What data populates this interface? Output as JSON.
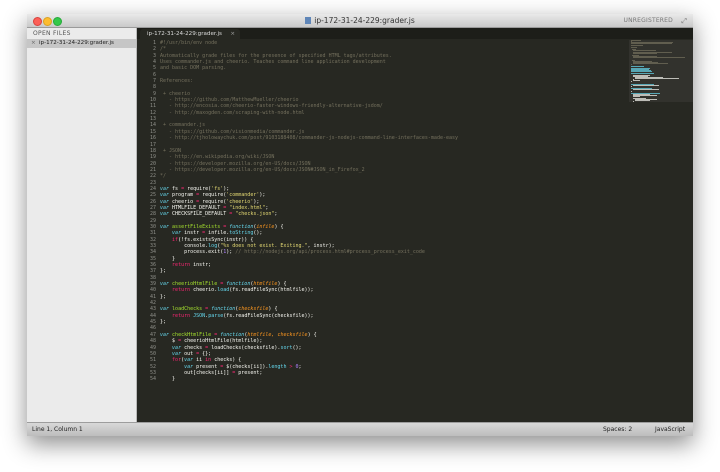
{
  "window": {
    "title": "ip-172-31-24-229:grader.js",
    "license": "UNREGISTERED"
  },
  "sidebar": {
    "header": "OPEN FILES",
    "files": [
      {
        "close": "×",
        "name": "ip-172-31-24-229:grader.js"
      }
    ]
  },
  "tabs": [
    {
      "label": "ip-172-31-24-229:grader.js",
      "close": "×"
    }
  ],
  "status": {
    "position": "Line 1, Column 1",
    "indent": "Spaces: 2",
    "syntax": "JavaScript"
  },
  "editor": {
    "lines": [
      [
        [
          "c",
          "#!/usr/bin/env node"
        ]
      ],
      [
        [
          "c",
          "/*"
        ]
      ],
      [
        [
          "c",
          "Automatically grade files for the presence of specified HTML tags/attributes."
        ]
      ],
      [
        [
          "c",
          "Uses commander.js and cheerio. Teaches command line application development"
        ]
      ],
      [
        [
          "c",
          "and basic DOM parsing."
        ]
      ],
      [],
      [
        [
          "c",
          "References:"
        ]
      ],
      [],
      [
        [
          "c",
          " + cheerio"
        ]
      ],
      [
        [
          "c",
          "   - https://github.com/MatthewMueller/cheerio"
        ]
      ],
      [
        [
          "c",
          "   - http://encosia.com/cheerio-faster-windows-friendly-alternative-jsdom/"
        ]
      ],
      [
        [
          "c",
          "   - http://maxogden.com/scraping-with-node.html"
        ]
      ],
      [],
      [
        [
          "c",
          " + commander.js"
        ]
      ],
      [
        [
          "c",
          "   - https://github.com/visionmedia/commander.js"
        ]
      ],
      [
        [
          "c",
          "   - http://tjholowaychuk.com/post/9103188408/commander-js-nodejs-command-line-interfaces-made-easy"
        ]
      ],
      [],
      [
        [
          "c",
          " + JSON"
        ]
      ],
      [
        [
          "c",
          "   - http://en.wikipedia.org/wiki/JSON"
        ]
      ],
      [
        [
          "c",
          "   - https://developer.mozilla.org/en-US/docs/JSON"
        ]
      ],
      [
        [
          "c",
          "   - https://developer.mozilla.org/en-US/docs/JSON#JSON_in_Firefox_2"
        ]
      ],
      [
        [
          "c",
          "*/"
        ]
      ],
      [],
      [
        [
          "kt",
          "var"
        ],
        [
          "t",
          " fs "
        ],
        [
          "k",
          "="
        ],
        [
          "t",
          " require("
        ],
        [
          "s",
          "'fs'"
        ],
        [
          "t",
          ");"
        ]
      ],
      [
        [
          "kt",
          "var"
        ],
        [
          "t",
          " program "
        ],
        [
          "k",
          "="
        ],
        [
          "t",
          " require("
        ],
        [
          "s",
          "'commander'"
        ],
        [
          "t",
          ");"
        ]
      ],
      [
        [
          "kt",
          "var"
        ],
        [
          "t",
          " cheerio "
        ],
        [
          "k",
          "="
        ],
        [
          "t",
          " require("
        ],
        [
          "s",
          "'cheerio'"
        ],
        [
          "t",
          ");"
        ]
      ],
      [
        [
          "kt",
          "var"
        ],
        [
          "t",
          " HTMLFILE_DEFAULT "
        ],
        [
          "k",
          "="
        ],
        [
          "t",
          " "
        ],
        [
          "s",
          "\"index.html\""
        ],
        [
          "t",
          ";"
        ]
      ],
      [
        [
          "kt",
          "var"
        ],
        [
          "t",
          " CHECKSFILE_DEFAULT "
        ],
        [
          "k",
          "="
        ],
        [
          "t",
          " "
        ],
        [
          "s",
          "\"checks.json\""
        ],
        [
          "t",
          ";"
        ]
      ],
      [],
      [
        [
          "kt",
          "var"
        ],
        [
          "t",
          " "
        ],
        [
          "f",
          "assertFileExists"
        ],
        [
          "t",
          " "
        ],
        [
          "k",
          "="
        ],
        [
          "t",
          " "
        ],
        [
          "kt",
          "function"
        ],
        [
          "t",
          "("
        ],
        [
          "p",
          "infile"
        ],
        [
          "t",
          ") {"
        ]
      ],
      [
        [
          "t",
          "    "
        ],
        [
          "kt",
          "var"
        ],
        [
          "t",
          " instr "
        ],
        [
          "k",
          "="
        ],
        [
          "t",
          " infile."
        ],
        [
          "b",
          "toString"
        ],
        [
          "t",
          "();"
        ]
      ],
      [
        [
          "t",
          "    "
        ],
        [
          "k",
          "if"
        ],
        [
          "t",
          "(!fs.existsSync(instr)) {"
        ]
      ],
      [
        [
          "t",
          "        console."
        ],
        [
          "b",
          "log"
        ],
        [
          "t",
          "("
        ],
        [
          "s",
          "\"%s does not exist. Exiting.\""
        ],
        [
          "t",
          ", instr);"
        ]
      ],
      [
        [
          "t",
          "        process.exit("
        ],
        [
          "n",
          "1"
        ],
        [
          "t",
          "); "
        ],
        [
          "c",
          "// http://nodejs.org/api/process.html#process_process_exit_code"
        ]
      ],
      [
        [
          "t",
          "    }"
        ]
      ],
      [
        [
          "t",
          "    "
        ],
        [
          "k",
          "return"
        ],
        [
          "t",
          " instr;"
        ]
      ],
      [
        [
          "t",
          "};"
        ]
      ],
      [],
      [
        [
          "kt",
          "var"
        ],
        [
          "t",
          " "
        ],
        [
          "f",
          "cheerioHtmlFile"
        ],
        [
          "t",
          " "
        ],
        [
          "k",
          "="
        ],
        [
          "t",
          " "
        ],
        [
          "kt",
          "function"
        ],
        [
          "t",
          "("
        ],
        [
          "p",
          "htmlfile"
        ],
        [
          "t",
          ") {"
        ]
      ],
      [
        [
          "t",
          "    "
        ],
        [
          "k",
          "return"
        ],
        [
          "t",
          " cheerio."
        ],
        [
          "b",
          "load"
        ],
        [
          "t",
          "(fs.readFileSync(htmlfile));"
        ]
      ],
      [
        [
          "t",
          "};"
        ]
      ],
      [],
      [
        [
          "kt",
          "var"
        ],
        [
          "t",
          " "
        ],
        [
          "f",
          "loadChecks"
        ],
        [
          "t",
          " "
        ],
        [
          "k",
          "="
        ],
        [
          "t",
          " "
        ],
        [
          "kt",
          "function"
        ],
        [
          "t",
          "("
        ],
        [
          "p",
          "checksfile"
        ],
        [
          "t",
          ") {"
        ]
      ],
      [
        [
          "t",
          "    "
        ],
        [
          "k",
          "return"
        ],
        [
          "t",
          " "
        ],
        [
          "b",
          "JSON"
        ],
        [
          "t",
          "."
        ],
        [
          "b",
          "parse"
        ],
        [
          "t",
          "(fs.readFileSync(checksfile));"
        ]
      ],
      [
        [
          "t",
          "};"
        ]
      ],
      [],
      [
        [
          "kt",
          "var"
        ],
        [
          "t",
          " "
        ],
        [
          "f",
          "checkHtmlFile"
        ],
        [
          "t",
          " "
        ],
        [
          "k",
          "="
        ],
        [
          "t",
          " "
        ],
        [
          "kt",
          "function"
        ],
        [
          "t",
          "("
        ],
        [
          "p",
          "htmlfile, checksfile"
        ],
        [
          "t",
          ") {"
        ]
      ],
      [
        [
          "t",
          "    $ "
        ],
        [
          "k",
          "="
        ],
        [
          "t",
          " cheerioHtmlFile(htmlfile);"
        ]
      ],
      [
        [
          "t",
          "    "
        ],
        [
          "kt",
          "var"
        ],
        [
          "t",
          " checks "
        ],
        [
          "k",
          "="
        ],
        [
          "t",
          " loadChecks(checksfile)."
        ],
        [
          "b",
          "sort"
        ],
        [
          "t",
          "();"
        ]
      ],
      [
        [
          "t",
          "    "
        ],
        [
          "kt",
          "var"
        ],
        [
          "t",
          " out "
        ],
        [
          "k",
          "="
        ],
        [
          "t",
          " {};"
        ]
      ],
      [
        [
          "t",
          "    "
        ],
        [
          "k",
          "for"
        ],
        [
          "t",
          "("
        ],
        [
          "kt",
          "var"
        ],
        [
          "t",
          " ii "
        ],
        [
          "k",
          "in"
        ],
        [
          "t",
          " checks) {"
        ]
      ],
      [
        [
          "t",
          "        "
        ],
        [
          "kt",
          "var"
        ],
        [
          "t",
          " present "
        ],
        [
          "k",
          "="
        ],
        [
          "t",
          " $(checks[ii])."
        ],
        [
          "b",
          "length"
        ],
        [
          "t",
          " "
        ],
        [
          "k",
          ">"
        ],
        [
          "t",
          " "
        ],
        [
          "n",
          "0"
        ],
        [
          "t",
          ";"
        ]
      ],
      [
        [
          "t",
          "        out[checks[ii]] "
        ],
        [
          "k",
          "="
        ],
        [
          "t",
          " present;"
        ]
      ],
      [
        [
          "t",
          "    }"
        ]
      ]
    ]
  },
  "colors": {
    "background": "#272822",
    "foreground": "#f8f8f2",
    "comment": "#75715e",
    "keyword": "#f92672",
    "string": "#e6db74",
    "function": "#a6e22e",
    "parameter": "#fd971f",
    "storage": "#66d9ef",
    "number": "#ae81ff"
  }
}
